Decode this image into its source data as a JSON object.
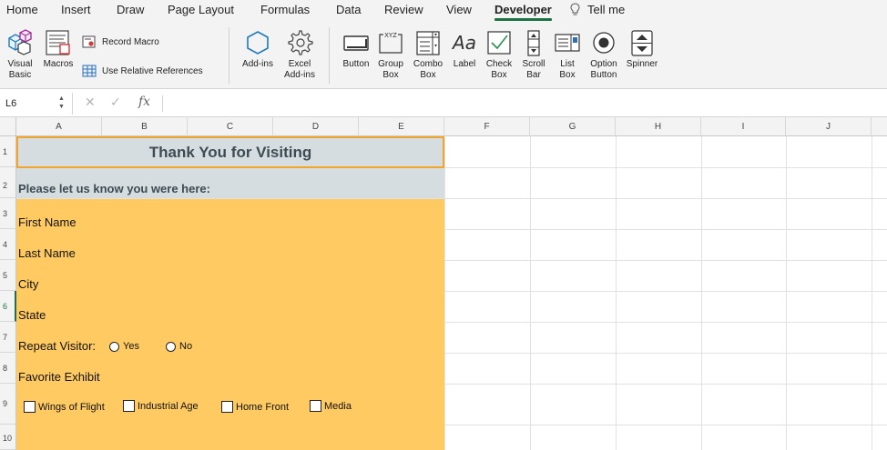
{
  "tabs": [
    "Home",
    "Insert",
    "Draw",
    "Page Layout",
    "Formulas",
    "Data",
    "Review",
    "View",
    "Developer"
  ],
  "active_tab": "Developer",
  "tell_me": "Tell me",
  "ribbon": {
    "visual_basic": [
      "Visual",
      "Basic"
    ],
    "macros": "Macros",
    "record_macro": "Record Macro",
    "relative_refs": "Use Relative References",
    "addins": "Add-ins",
    "excel_addins": [
      "Excel",
      "Add-ins"
    ],
    "button": "Button",
    "group_box": [
      "Group",
      "Box"
    ],
    "combo_box": [
      "Combo",
      "Box"
    ],
    "label": "Label",
    "check_box": [
      "Check",
      "Box"
    ],
    "scroll_bar": [
      "Scroll",
      "Bar"
    ],
    "list_box": [
      "List",
      "Box"
    ],
    "option_button": [
      "Option",
      "Button"
    ],
    "spinner": "Spinner",
    "group_box_glyph": "XYZ",
    "label_glyph": "Aa"
  },
  "formula_bar": {
    "name_box": "L6",
    "fx": "fx",
    "value": ""
  },
  "columns": [
    "A",
    "B",
    "C",
    "D",
    "E",
    "F",
    "G",
    "H",
    "I",
    "J"
  ],
  "rows": [
    "1",
    "2",
    "3",
    "4",
    "5",
    "6",
    "7",
    "8",
    "9",
    "10"
  ],
  "selected_row": "6",
  "sheet": {
    "title": "Thank You for Visiting",
    "subtitle": "Please let us know you were here:",
    "first_name": "First Name",
    "last_name": "Last Name",
    "city": "City",
    "state": "State",
    "repeat_visitor": "Repeat Visitor:",
    "yes": "Yes",
    "no": "No",
    "favorite_exhibit": "Favorite Exhibit",
    "exhibits": [
      "Wings of Flight",
      "Industrial Age",
      "Home Front",
      "Media"
    ]
  },
  "colors": {
    "title_fill": "#d6dde1",
    "form_fill": "#ffca62",
    "selection_border": "#f2a529",
    "accent": "#1e7145"
  }
}
